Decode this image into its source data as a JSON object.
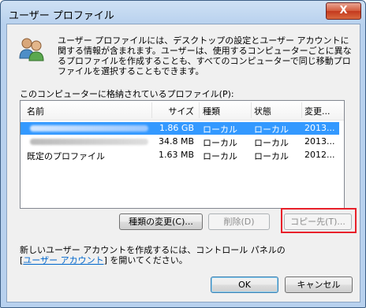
{
  "window": {
    "title": "ユーザー プロファイル",
    "close_symbol": "X"
  },
  "description": "ユーザー プロファイルには、デスクトップの設定とユーザー アカウントに関する情報が含まれます。ユーザーは、使用するコンピューターごとに異なるプロファイルを作成することも、すべてのコンピューターで同じ移動プロファイルを選択することもできます。",
  "list": {
    "label": "このコンピューターに格納されているプロファイル(P):",
    "columns": [
      "名前",
      "サイズ",
      "種類",
      "状態",
      "変更..."
    ],
    "rows": [
      {
        "name": "",
        "size": "1.86 GB",
        "type": "ローカル",
        "status": "ローカル",
        "modified": "2013...",
        "selected": true,
        "name_obscured": true
      },
      {
        "name": "",
        "size": "34.8 MB",
        "type": "ローカル",
        "status": "ローカル",
        "modified": "2013...",
        "selected": false,
        "name_obscured": true
      },
      {
        "name": "既定のプロファイル",
        "size": "1.63 MB",
        "type": "ローカル",
        "status": "ローカル",
        "modified": "2012...",
        "selected": false,
        "name_obscured": false
      }
    ]
  },
  "buttons": {
    "change_type": "種類の変更(C)...",
    "delete": "削除(D)",
    "copy_to": "コピー先(T)...",
    "ok": "OK",
    "cancel": "キャンセル"
  },
  "info": {
    "line1": "新しいユーザー アカウントを作成するには、コントロール パネルの",
    "link_open": "[",
    "link": "ユーザー アカウント",
    "line2_suffix": "] を開いてください。"
  },
  "colors": {
    "selection": "#3399ff",
    "highlight_border": "#e8202a",
    "link": "#0066cc"
  },
  "icons": {
    "users": "users-icon",
    "close": "close-icon"
  }
}
